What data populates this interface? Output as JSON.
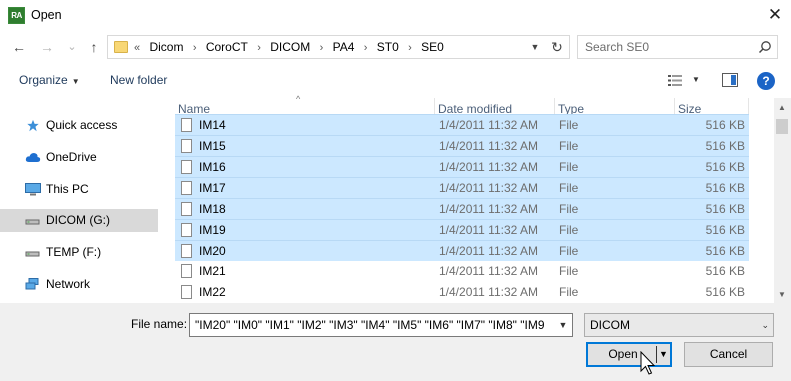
{
  "window": {
    "title": "Open",
    "app_icon_text": "RA",
    "close_glyph": "✕"
  },
  "nav": {
    "back_glyph": "←",
    "forward_glyph": "→",
    "recent_glyph": "⌄",
    "up_glyph": "↑",
    "breadcrumb_overflow": "«",
    "breadcrumbs": [
      "Dicom",
      "CoroCT",
      "DICOM",
      "PA4",
      "ST0",
      "SE0"
    ],
    "separator": "›",
    "refresh_glyph": "↻",
    "search_placeholder": "Search SE0"
  },
  "toolbar": {
    "organize_label": "Organize",
    "new_folder_label": "New folder",
    "help_glyph": "?"
  },
  "sidebar": {
    "items": [
      {
        "label": "Quick access",
        "icon": "star-icon"
      },
      {
        "label": "OneDrive",
        "icon": "cloud-icon"
      },
      {
        "label": "This PC",
        "icon": "computer-icon"
      },
      {
        "label": "DICOM (G:)",
        "icon": "drive-icon",
        "selected": true
      },
      {
        "label": "TEMP (F:)",
        "icon": "drive-icon"
      },
      {
        "label": "Network",
        "icon": "network-icon"
      }
    ]
  },
  "columns": {
    "name": "Name",
    "date": "Date modified",
    "type": "Type",
    "size": "Size"
  },
  "files": [
    {
      "name": "IM14",
      "date": "1/4/2011 11:32 AM",
      "type": "File",
      "size": "516 KB",
      "selected": true
    },
    {
      "name": "IM15",
      "date": "1/4/2011 11:32 AM",
      "type": "File",
      "size": "516 KB",
      "selected": true
    },
    {
      "name": "IM16",
      "date": "1/4/2011 11:32 AM",
      "type": "File",
      "size": "516 KB",
      "selected": true
    },
    {
      "name": "IM17",
      "date": "1/4/2011 11:32 AM",
      "type": "File",
      "size": "516 KB",
      "selected": true
    },
    {
      "name": "IM18",
      "date": "1/4/2011 11:32 AM",
      "type": "File",
      "size": "516 KB",
      "selected": true
    },
    {
      "name": "IM19",
      "date": "1/4/2011 11:32 AM",
      "type": "File",
      "size": "516 KB",
      "selected": true
    },
    {
      "name": "IM20",
      "date": "1/4/2011 11:32 AM",
      "type": "File",
      "size": "516 KB",
      "selected": true
    },
    {
      "name": "IM21",
      "date": "1/4/2011 11:32 AM",
      "type": "File",
      "size": "516 KB",
      "selected": false
    },
    {
      "name": "IM22",
      "date": "1/4/2011 11:32 AM",
      "type": "File",
      "size": "516 KB",
      "selected": false
    }
  ],
  "footer": {
    "file_name_label": "File name:",
    "file_name_value": "\"IM20\" \"IM0\" \"IM1\" \"IM2\" \"IM3\" \"IM4\" \"IM5\" \"IM6\" \"IM7\" \"IM8\" \"IM9",
    "file_type_value": "DICOM",
    "open_label": "Open",
    "cancel_label": "Cancel"
  },
  "colors": {
    "selection": "#cce8ff",
    "accent": "#0078d7"
  }
}
